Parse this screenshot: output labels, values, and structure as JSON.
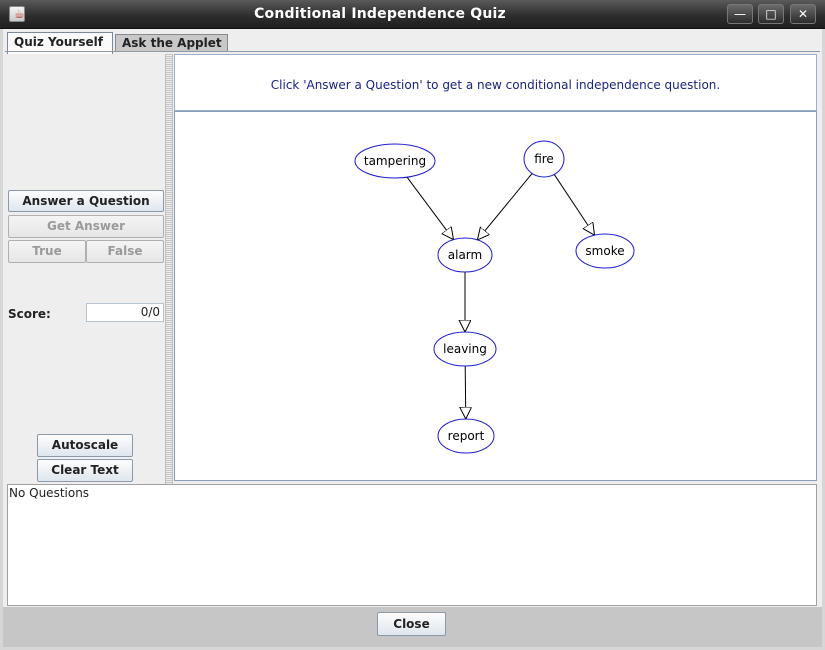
{
  "window": {
    "title": "Conditional Independence Quiz",
    "icon": "java-icon"
  },
  "tabs": [
    {
      "label": "Quiz Yourself",
      "active": true
    },
    {
      "label": "Ask the Applet",
      "active": false
    }
  ],
  "left": {
    "answer_label": "Answer a Question",
    "get_answer_label": "Get Answer",
    "true_label": "True",
    "false_label": "False",
    "score_label": "Score:",
    "score_value": "0/0",
    "autoscale_label": "Autoscale",
    "clear_text_label": "Clear Text"
  },
  "message": "Click 'Answer a Question' to get a new conditional independence question.",
  "graph": {
    "nodes": [
      "tampering",
      "fire",
      "alarm",
      "smoke",
      "leaving",
      "report"
    ],
    "edges": [
      [
        "tampering",
        "alarm"
      ],
      [
        "fire",
        "alarm"
      ],
      [
        "fire",
        "smoke"
      ],
      [
        "alarm",
        "leaving"
      ],
      [
        "leaving",
        "report"
      ]
    ],
    "node_stroke": "#1a1acc"
  },
  "output_text": "No Questions",
  "footer": {
    "close_label": "Close"
  }
}
